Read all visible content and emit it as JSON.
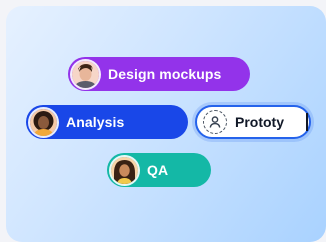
{
  "chips": {
    "design": {
      "label": "Design mockups"
    },
    "analysis": {
      "label": "Analysis"
    },
    "qa": {
      "label": "QA"
    }
  },
  "input": {
    "value": "Prototy",
    "icon": "person-icon"
  },
  "colors": {
    "design": "#9333ea",
    "analysis": "#1947e8",
    "qa": "#14b8a6",
    "focus": "#2563eb"
  }
}
